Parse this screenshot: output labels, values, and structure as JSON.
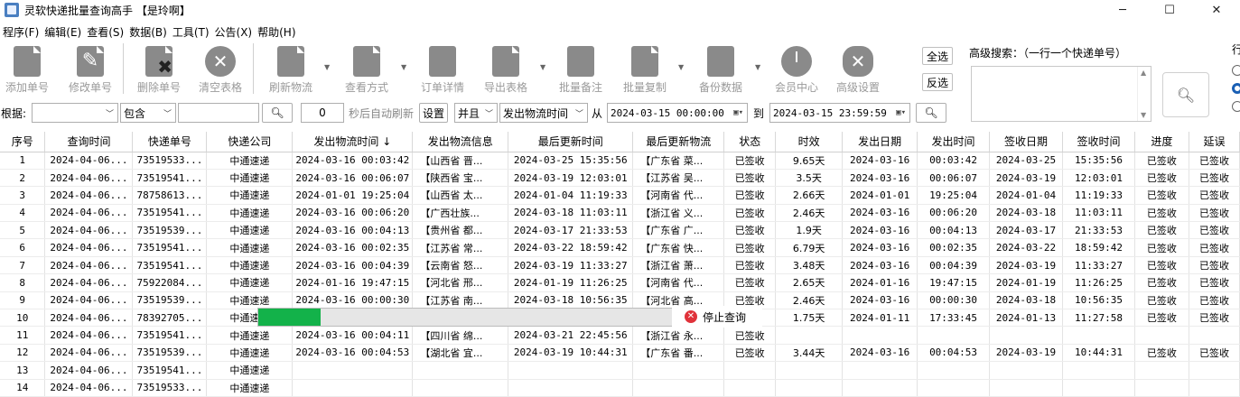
{
  "window": {
    "title": "灵软快递批量查询高手 【是玲啊】",
    "minimize": "─",
    "maximize": "☐",
    "close": "✕"
  },
  "menu": [
    "程序(F)",
    "编辑(E)",
    "查看(S)",
    "数据(B)",
    "工具(T)",
    "公告(X)",
    "帮助(H)"
  ],
  "toolbar": {
    "add": "添加单号",
    "edit": "修改单号",
    "delete": "删除单号",
    "clear": "清空表格",
    "refresh": "刷新物流",
    "view_mode": "查看方式",
    "order_detail": "订单详情",
    "export": "导出表格",
    "batch_note": "批量备注",
    "batch_copy": "批量复制",
    "backup": "备份数据",
    "member": "会员中心",
    "advanced": "高级设置"
  },
  "side": {
    "select_all": "全选",
    "invert": "反选",
    "adv_label": "高级搜索：（一行一个快递单号）",
    "edge_label": "行"
  },
  "filter": {
    "by_label": "根据:",
    "by_value": "",
    "match_value": "包含",
    "keyword": "",
    "interval": "0",
    "auto_label": "秒后自动刷新",
    "set": "设置",
    "logic": "并且",
    "field": "发出物流时间",
    "from_label": "从",
    "from": "2024-03-15 00:00:00",
    "to_label": "到",
    "to": "2024-03-15 23:59:59"
  },
  "columns": [
    "序号",
    "查询时间",
    "快递单号",
    "快递公司",
    "发出物流时间 ↓",
    "发出物流信息",
    "最后更新时间",
    "最后更新物流",
    "状态",
    "时效",
    "发出日期",
    "发出时间",
    "签收日期",
    "签收时间",
    "进度",
    "延误"
  ],
  "rows": [
    [
      "1",
      "2024-04-06...",
      "73519533...",
      "中通速递",
      "2024-03-16 00:03:42",
      "【山西省 晋...",
      "2024-03-25 15:35:56",
      "【广东省 菜...",
      "已签收",
      "9.65天",
      "2024-03-16",
      "00:03:42",
      "2024-03-25",
      "15:35:56",
      "已签收",
      "已签收"
    ],
    [
      "2",
      "2024-04-06...",
      "73519541...",
      "中通速递",
      "2024-03-16 00:06:07",
      "【陕西省 宝...",
      "2024-03-19 12:03:01",
      "【江苏省 吴...",
      "已签收",
      "3.5天",
      "2024-03-16",
      "00:06:07",
      "2024-03-19",
      "12:03:01",
      "已签收",
      "已签收"
    ],
    [
      "3",
      "2024-04-06...",
      "78758613...",
      "中通速递",
      "2024-01-01 19:25:04",
      "【山西省 太...",
      "2024-01-04 11:19:33",
      "【河南省 代...",
      "已签收",
      "2.66天",
      "2024-01-01",
      "19:25:04",
      "2024-01-04",
      "11:19:33",
      "已签收",
      "已签收"
    ],
    [
      "4",
      "2024-04-06...",
      "73519541...",
      "中通速递",
      "2024-03-16 00:06:20",
      "【广西壮族...",
      "2024-03-18 11:03:11",
      "【浙江省 义...",
      "已签收",
      "2.46天",
      "2024-03-16",
      "00:06:20",
      "2024-03-18",
      "11:03:11",
      "已签收",
      "已签收"
    ],
    [
      "5",
      "2024-04-06...",
      "73519539...",
      "中通速递",
      "2024-03-16 00:04:13",
      "【贵州省 都...",
      "2024-03-17 21:33:53",
      "【广东省 广...",
      "已签收",
      "1.9天",
      "2024-03-16",
      "00:04:13",
      "2024-03-17",
      "21:33:53",
      "已签收",
      "已签收"
    ],
    [
      "6",
      "2024-04-06...",
      "73519541...",
      "中通速递",
      "2024-03-16 00:02:35",
      "【江苏省 常...",
      "2024-03-22 18:59:42",
      "【广东省 快...",
      "已签收",
      "6.79天",
      "2024-03-16",
      "00:02:35",
      "2024-03-22",
      "18:59:42",
      "已签收",
      "已签收"
    ],
    [
      "7",
      "2024-04-06...",
      "73519541...",
      "中通速递",
      "2024-03-16 00:04:39",
      "【云南省 怒...",
      "2024-03-19 11:33:27",
      "【浙江省 萧...",
      "已签收",
      "3.48天",
      "2024-03-16",
      "00:04:39",
      "2024-03-19",
      "11:33:27",
      "已签收",
      "已签收"
    ],
    [
      "8",
      "2024-04-06...",
      "75922084...",
      "中通速递",
      "2024-01-16 19:47:15",
      "【河北省 邢...",
      "2024-01-19 11:26:25",
      "【河南省 代...",
      "已签收",
      "2.65天",
      "2024-01-16",
      "19:47:15",
      "2024-01-19",
      "11:26:25",
      "已签收",
      "已签收"
    ],
    [
      "9",
      "2024-04-06...",
      "73519539...",
      "中通速递",
      "2024-03-16 00:00:30",
      "【江苏省 南...",
      "2024-03-18 10:56:35",
      "【河北省 高...",
      "已签收",
      "2.46天",
      "2024-03-16",
      "00:00:30",
      "2024-03-18",
      "10:56:35",
      "已签收",
      "已签收"
    ],
    [
      "10",
      "2024-04-06...",
      "78392705...",
      "中通速递",
      "",
      "",
      "",
      "",
      "收",
      "1.75天",
      "2024-01-11",
      "17:33:45",
      "2024-01-13",
      "11:27:58",
      "已签收",
      "已签收"
    ],
    [
      "11",
      "2024-04-06...",
      "73519541...",
      "中通速递",
      "2024-03-16 00:04:11",
      "【四川省 绵...",
      "2024-03-21 22:45:56",
      "【浙江省 永...",
      "已签收",
      "",
      "",
      "",
      "",
      "",
      "",
      ""
    ],
    [
      "12",
      "2024-04-06...",
      "73519539...",
      "中通速递",
      "2024-03-16 00:04:53",
      "【湖北省 宜...",
      "2024-03-19 10:44:31",
      "【广东省 番...",
      "已签收",
      "3.44天",
      "2024-03-16",
      "00:04:53",
      "2024-03-19",
      "10:44:31",
      "已签收",
      "已签收"
    ],
    [
      "13",
      "2024-04-06...",
      "73519541...",
      "中通速递",
      "",
      "",
      "",
      "",
      "",
      "",
      "",
      "",
      "",
      "",
      "",
      ""
    ],
    [
      "14",
      "2024-04-06...",
      "73519533...",
      "中通速递",
      "",
      "",
      "",
      "",
      "",
      "",
      "",
      "",
      "",
      "",
      "",
      ""
    ]
  ],
  "progress": {
    "fraction": 0.15,
    "color": "#13b24a",
    "stop_label": "停止查询"
  },
  "icons": {
    "search": "magnifier-icon",
    "stop": "stop-icon"
  }
}
